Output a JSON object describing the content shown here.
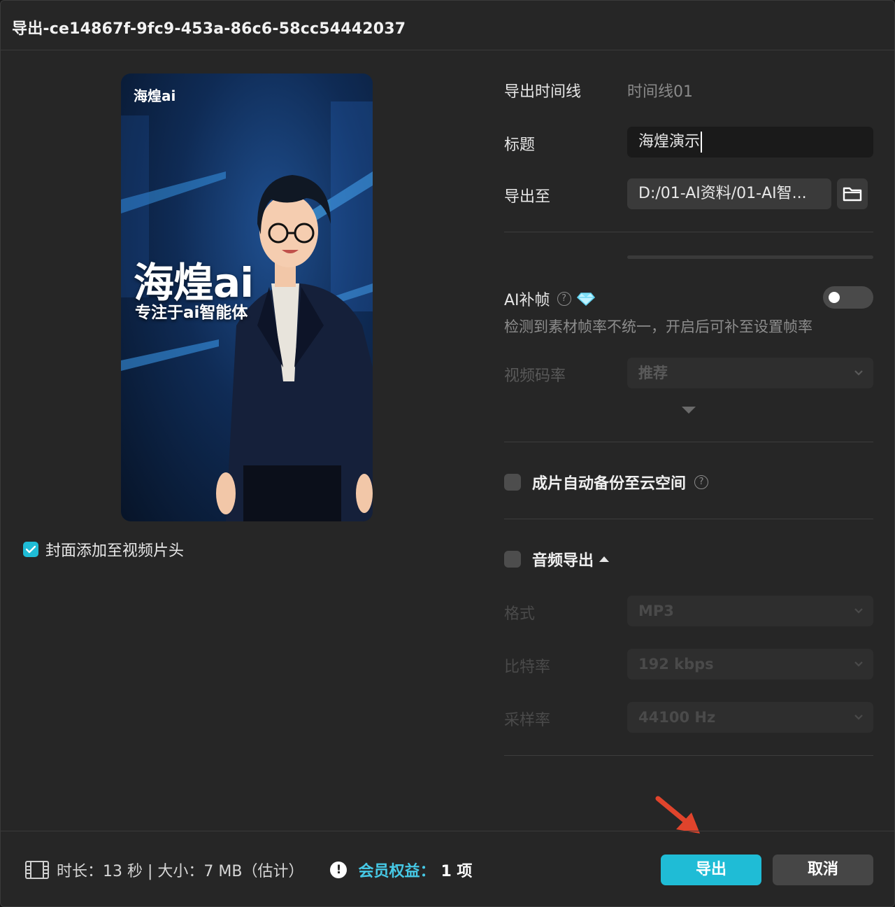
{
  "window": {
    "title": "导出-ce14867f-9fc9-453a-86c6-58cc54442037"
  },
  "cover": {
    "brand_small": "海煌ai",
    "brand_big": "海煌ai",
    "brand_sub": "专注于ai智能体",
    "add_to_start_checked": true,
    "add_to_start_label": "封面添加至视频片头"
  },
  "form": {
    "timeline_label": "导出时间线",
    "timeline_value": "时间线01",
    "title_label": "标题",
    "title_value": "海煌演示",
    "export_to_label": "导出至",
    "export_to_value": "D:/01-AI资料/01-AI智...",
    "ai_frame_label": "AI补帧",
    "ai_frame_enabled": false,
    "ai_frame_desc": "检测到素材帧率不统一，开启后可补至设置帧率",
    "bitrate_label": "视频码率",
    "bitrate_value": "推荐",
    "cloud_backup_label": "成片自动备份至云空间",
    "cloud_backup_checked": false,
    "audio_export_label": "音频导出",
    "audio_export_checked": false,
    "audio_format_label": "格式",
    "audio_format_value": "MP3",
    "audio_bitrate_label": "比特率",
    "audio_bitrate_value": "192 kbps",
    "sample_rate_label": "采样率",
    "sample_rate_value": "44100 Hz"
  },
  "footer": {
    "info": "时长：13 秒 | 大小：7 MB（估计）",
    "member_label": "会员权益：",
    "member_count": "1 项",
    "export_button": "导出",
    "cancel_button": "取消"
  },
  "colors": {
    "accent": "#1fbcd6",
    "member_text": "#46c9e6",
    "annotation_arrow": "#e0442c"
  }
}
